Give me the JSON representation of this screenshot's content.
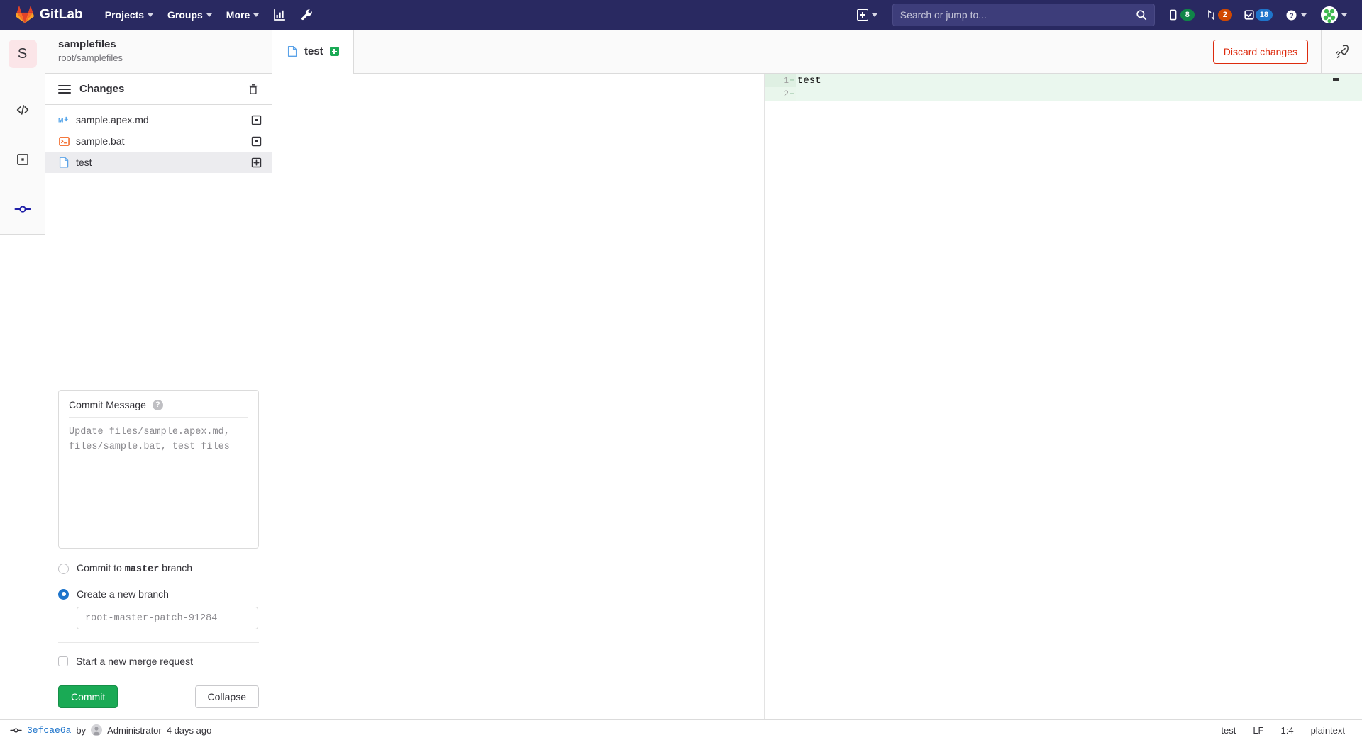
{
  "navbar": {
    "brand": "GitLab",
    "items": [
      {
        "label": "Projects",
        "icon": "chevron-down-icon"
      },
      {
        "label": "Groups",
        "icon": "chevron-down-icon"
      },
      {
        "label": "More",
        "icon": "chevron-down-icon"
      }
    ],
    "icon_buttons": [
      {
        "name": "analytics-icon"
      },
      {
        "name": "wrench-icon"
      }
    ],
    "create_new": {
      "icon": "plus-square-icon",
      "label": ""
    },
    "search": {
      "placeholder": "Search or jump to...",
      "value": "",
      "icon": "search-icon"
    },
    "badges": [
      {
        "name": "issues-icon",
        "count": "8",
        "color": "#108548"
      },
      {
        "name": "merge-requests-icon",
        "count": "2",
        "color": "#d14800"
      },
      {
        "name": "todos-icon",
        "count": "18",
        "color": "#1f75cb"
      }
    ],
    "help": {
      "icon": "help-circle-icon"
    },
    "user": {
      "icon": "avatar"
    }
  },
  "activity_bar": {
    "project_initial": "S",
    "items": [
      {
        "name": "edit-code-icon",
        "active": false
      },
      {
        "name": "review-changes-icon",
        "active": false
      },
      {
        "name": "commit-icon",
        "active": true
      }
    ]
  },
  "sidebar": {
    "project_name": "samplefiles",
    "project_path": "root/samplefiles",
    "panel": {
      "title": "Changes",
      "menu_icon": "hamburger-icon",
      "discard_all_icon": "trash-icon"
    },
    "files": [
      {
        "name": "sample.apex.md",
        "icon": "markdown-file-icon",
        "action_icon": "stage-change-icon",
        "active": false
      },
      {
        "name": "sample.bat",
        "icon": "batch-file-icon",
        "action_icon": "stage-change-icon",
        "active": false
      },
      {
        "name": "test",
        "icon": "plain-file-icon",
        "action_icon": "stage-new-file-icon",
        "active": true
      }
    ],
    "commit": {
      "message_label": "Commit Message",
      "help_icon": "question-mark-icon",
      "message_value": "",
      "message_placeholder": "Update files/sample.apex.md, files/sample.bat, test files",
      "options": [
        {
          "label_prefix": "Commit to ",
          "label_code": "master",
          "label_suffix": " branch",
          "selected": false
        },
        {
          "label_prefix": "Create a new branch",
          "label_code": "",
          "label_suffix": "",
          "selected": true
        }
      ],
      "branch_value": "",
      "branch_placeholder": "root-master-patch-91284",
      "merge_request_label": "Start a new merge request",
      "merge_request_checked": false,
      "commit_button": "Commit",
      "collapse_button": "Collapse"
    }
  },
  "editor": {
    "tab": {
      "filename": "test",
      "icon": "plain-file-icon",
      "status_icon": "new-file-badge"
    },
    "discard_button": "Discard changes",
    "rocket_icon": "rocket-icon",
    "diff": {
      "lines": [
        {
          "number": "1",
          "marker": "+",
          "text": "test",
          "current": true
        },
        {
          "number": "2",
          "marker": "+",
          "text": "",
          "current": false
        }
      ]
    }
  },
  "statusbar": {
    "commit_icon": "commit-icon",
    "commit_id": "3efcae6a",
    "by_label": "by",
    "author_avatar": "avatar",
    "author": "Administrator",
    "time": "4 days ago",
    "right_items": [
      {
        "name": "branch-name",
        "label": "test"
      },
      {
        "name": "line-ending",
        "label": "LF"
      },
      {
        "name": "cursor-position",
        "label": "1:4"
      },
      {
        "name": "language-mode",
        "label": "plaintext"
      }
    ]
  }
}
